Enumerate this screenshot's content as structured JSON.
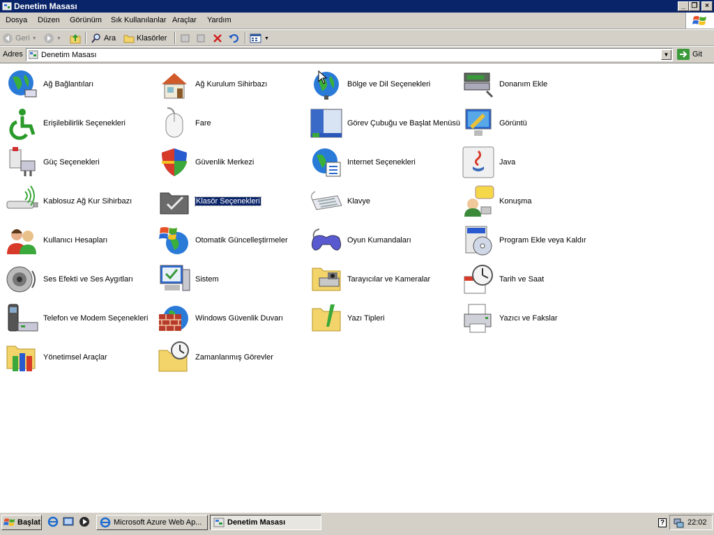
{
  "window": {
    "title": "Denetim Masası"
  },
  "menu": [
    "Dosya",
    "Düzen",
    "Görünüm",
    "Sık Kullanılanlar",
    "Araçlar",
    "Yardım"
  ],
  "toolbar": {
    "back": "Geri",
    "search": "Ara",
    "folders": "Klasörler"
  },
  "address": {
    "label": "Adres",
    "value": "Denetim Masası",
    "go": "Git"
  },
  "items": [
    {
      "label": "Ağ Bağlantıları",
      "icon": "network-connections-icon"
    },
    {
      "label": "Ağ Kurulum Sihirbazı",
      "icon": "network-setup-wizard-icon"
    },
    {
      "label": "Bölge ve Dil Seçenekleri",
      "icon": "regional-language-icon"
    },
    {
      "label": "Donanım Ekle",
      "icon": "add-hardware-icon"
    },
    {
      "label": "Erişilebilirlik Seçenekleri",
      "icon": "accessibility-icon"
    },
    {
      "label": "Fare",
      "icon": "mouse-icon"
    },
    {
      "label": "Görev Çubuğu ve Başlat Menüsü",
      "icon": "taskbar-start-menu-icon"
    },
    {
      "label": "Görüntü",
      "icon": "display-icon"
    },
    {
      "label": "Güç Seçenekleri",
      "icon": "power-options-icon"
    },
    {
      "label": "Güvenlik Merkezi",
      "icon": "security-center-icon"
    },
    {
      "label": "Internet Seçenekleri",
      "icon": "internet-options-icon"
    },
    {
      "label": "Java",
      "icon": "java-icon"
    },
    {
      "label": "Kablosuz Ağ Kur Sihirbazı",
      "icon": "wireless-setup-icon"
    },
    {
      "label": "Klasör Seçenekleri",
      "icon": "folder-options-icon"
    },
    {
      "label": "Klavye",
      "icon": "keyboard-icon"
    },
    {
      "label": "Konuşma",
      "icon": "speech-icon"
    },
    {
      "label": "Kullanıcı Hesapları",
      "icon": "user-accounts-icon"
    },
    {
      "label": "Otomatik Güncelleştirmeler",
      "icon": "automatic-updates-icon"
    },
    {
      "label": "Oyun Kumandaları",
      "icon": "game-controllers-icon"
    },
    {
      "label": "Program Ekle veya Kaldır",
      "icon": "add-remove-programs-icon"
    },
    {
      "label": "Ses Efekti ve Ses Aygıtları",
      "icon": "sounds-audio-icon"
    },
    {
      "label": "Sistem",
      "icon": "system-icon"
    },
    {
      "label": "Tarayıcılar ve Kameralar",
      "icon": "scanners-cameras-icon"
    },
    {
      "label": "Tarih ve Saat",
      "icon": "date-time-icon"
    },
    {
      "label": "Telefon ve Modem Seçenekleri",
      "icon": "phone-modem-icon"
    },
    {
      "label": "Windows Güvenlik Duvarı",
      "icon": "windows-firewall-icon"
    },
    {
      "label": "Yazı Tipleri",
      "icon": "fonts-icon"
    },
    {
      "label": "Yazıcı ve Fakslar",
      "icon": "printers-faxes-icon"
    },
    {
      "label": "Yönetimsel Araçlar",
      "icon": "administrative-tools-icon"
    },
    {
      "label": "Zamanlanmış Görevler",
      "icon": "scheduled-tasks-icon"
    }
  ],
  "selected_item": "Klasör Seçenekleri",
  "taskbar": {
    "start": "Başlat",
    "tasks": [
      {
        "label": "Microsoft Azure Web Ap...",
        "active": false
      },
      {
        "label": "Denetim Masası",
        "active": true
      }
    ],
    "clock": "22:02"
  },
  "colors": {
    "titlebar": "#0a246a",
    "face": "#d4d0c8",
    "selection": "#0a246a"
  }
}
